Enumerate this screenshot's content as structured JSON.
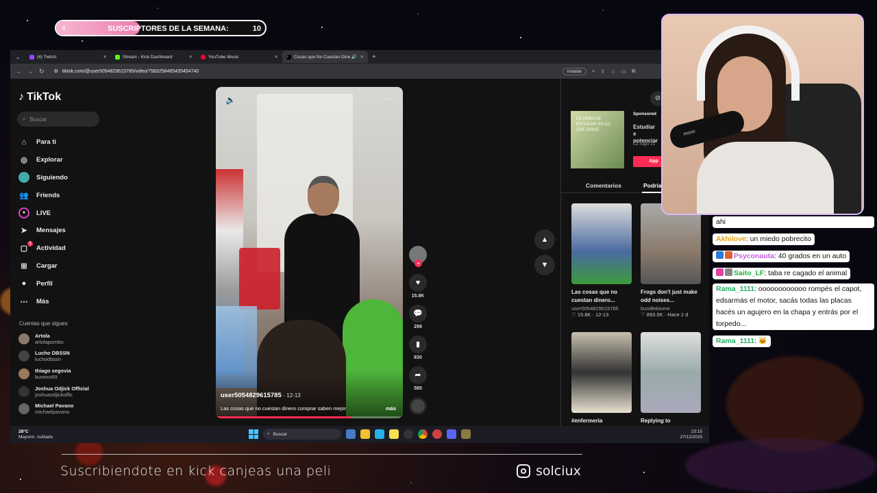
{
  "goal": {
    "current": "4",
    "label": "SUSCRIPTORES DE LA SEMANA:",
    "target": "10",
    "progress": 0.4
  },
  "browser": {
    "tabs": [
      {
        "label": "(4) Twitch",
        "color": "#9146ff"
      },
      {
        "label": "Stream - Kick Dashboard",
        "color": "#53fc18"
      },
      {
        "label": "YouTube Music",
        "color": "#ff0033"
      },
      {
        "label": "Cosas que No Cuestan Dine",
        "color": "#ffffff"
      }
    ],
    "url": "tiktok.com/@user5054829615785/video/7583258465435454740",
    "install_label": "Instalar"
  },
  "tiktok": {
    "logo": "TikTok",
    "search_placeholder": "Buscar",
    "menu": [
      {
        "label": "Para ti",
        "icon": "home-icon"
      },
      {
        "label": "Explorar",
        "icon": "compass-icon"
      },
      {
        "label": "Siguiendo",
        "icon": "following-avatar-icon"
      },
      {
        "label": "Friends",
        "icon": "friends-icon"
      },
      {
        "label": "LIVE",
        "icon": "live-icon"
      },
      {
        "label": "Mensajes",
        "icon": "messages-icon"
      },
      {
        "label": "Actividad",
        "icon": "activity-icon",
        "badge": "1"
      },
      {
        "label": "Cargar",
        "icon": "upload-icon"
      },
      {
        "label": "Perfil",
        "icon": "profile-icon"
      },
      {
        "label": "Más",
        "icon": "more-icon"
      }
    ],
    "following_title": "Cuentas que sigues",
    "following": [
      {
        "name": "Artola",
        "handle": "artolapombo"
      },
      {
        "name": "Lucho DBSSN",
        "handle": "luchodbssn"
      },
      {
        "name": "thiago segovia",
        "handle": "busexo69"
      },
      {
        "name": "Joshua Odjick Official",
        "handle": "joshuaodjickoffic"
      },
      {
        "name": "Michael Pavano",
        "handle": "michaelpavano"
      }
    ],
    "video": {
      "user": "user5054829615785",
      "date": "· 12-13",
      "caption": "Las cosas que no cuestan dinero comprar saben mejor",
      "more": "más",
      "progress": 0.72
    },
    "actions": {
      "likes": "15.8K",
      "comments": "296",
      "saves": "830",
      "shares": "585"
    },
    "ad": {
      "sponsored": "Sponsored",
      "title": "Estudiar e potenciar",
      "brand": "La Siglo 21",
      "button": "App",
      "image_text": "ES HORA DE ESTUDIAR ES LO QUE SIGUE"
    },
    "panel_tabs": [
      "Comentarios",
      "Podría"
    ],
    "grid": [
      {
        "title": "Las cosas que no cuestan dinero...",
        "user": "user5054829615785",
        "meta": "♡ 15.8K · 12-13"
      },
      {
        "title": "Frogs don't just make odd noises...",
        "user": "bundlebiome",
        "meta": "♡ 893.5K · Hace 2 d"
      },
      {
        "title": "#enfermeria",
        "user": "",
        "meta": ""
      },
      {
        "title": "Replying to",
        "user": "",
        "meta": ""
      }
    ]
  },
  "taskbar": {
    "temp": "28°C",
    "weather": "Mayorm. nublado",
    "search": "Buscar",
    "time": "23:15",
    "date": "27/12/2025"
  },
  "webcam": {
    "mic_brand": "moon"
  },
  "chat": [
    {
      "user": "",
      "text": "ahi",
      "color": "#000000"
    },
    {
      "user": "Akhilove",
      "text": ": un miedo pobrecito",
      "color": "#e0a020"
    },
    {
      "user": "Psyconauta",
      "text": ": 40 grados en un auto",
      "color": "#c060e0"
    },
    {
      "user": "Saito_LF",
      "text": ": taba re cagado el animal",
      "color": "#20b040"
    },
    {
      "user": "Rama_1111",
      "text": ": oooooooooooo rompés el capot, edsarmás el motor, sacás todas las placas hacés un agujero en la chapa y entrás por el torpedo...",
      "color": "#20b060"
    },
    {
      "user": "Rama_1111",
      "text": ": 🐱",
      "color": "#20b060"
    }
  ],
  "footer": {
    "text": "Suscribiendote en kick canjeas una peli",
    "instagram": "solciux"
  }
}
